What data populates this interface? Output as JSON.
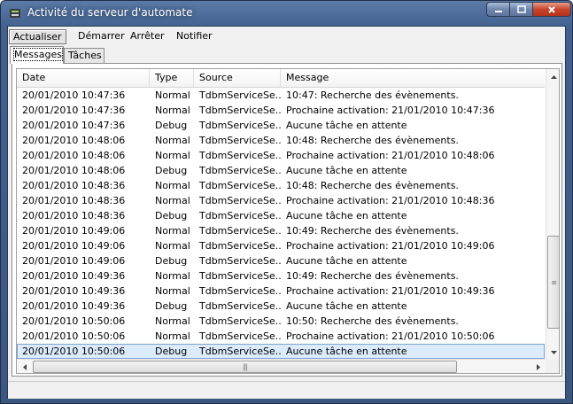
{
  "window": {
    "title": "Activité du serveur d'automate"
  },
  "menu": [
    {
      "label": "Actualiser"
    },
    {
      "label": "Démarrer"
    },
    {
      "label": "Arrêter"
    },
    {
      "label": "Notifier"
    }
  ],
  "tabs": [
    {
      "label": "Messages",
      "active": true
    },
    {
      "label": "Tâches",
      "active": false
    }
  ],
  "table": {
    "columns": [
      "Date",
      "Type",
      "Source",
      "Message"
    ],
    "rows": [
      [
        "20/01/2010 10:47:36",
        "Normal",
        "TdbmServiceSe...",
        "10:47: Recherche des évènements."
      ],
      [
        "20/01/2010 10:47:36",
        "Normal",
        "TdbmServiceSe...",
        "Prochaine activation: 21/01/2010 10:47:36"
      ],
      [
        "20/01/2010 10:47:36",
        "Debug",
        "TdbmServiceSe...",
        "Aucune tâche en attente"
      ],
      [
        "20/01/2010 10:48:06",
        "Normal",
        "TdbmServiceSe...",
        "10:48: Recherche des évènements."
      ],
      [
        "20/01/2010 10:48:06",
        "Normal",
        "TdbmServiceSe...",
        "Prochaine activation: 21/01/2010 10:48:06"
      ],
      [
        "20/01/2010 10:48:06",
        "Debug",
        "TdbmServiceSe...",
        "Aucune tâche en attente"
      ],
      [
        "20/01/2010 10:48:36",
        "Normal",
        "TdbmServiceSe...",
        "10:48: Recherche des évènements."
      ],
      [
        "20/01/2010 10:48:36",
        "Normal",
        "TdbmServiceSe...",
        "Prochaine activation: 21/01/2010 10:48:36"
      ],
      [
        "20/01/2010 10:48:36",
        "Debug",
        "TdbmServiceSe...",
        "Aucune tâche en attente"
      ],
      [
        "20/01/2010 10:49:06",
        "Normal",
        "TdbmServiceSe...",
        "10:49: Recherche des évènements."
      ],
      [
        "20/01/2010 10:49:06",
        "Normal",
        "TdbmServiceSe...",
        "Prochaine activation: 21/01/2010 10:49:06"
      ],
      [
        "20/01/2010 10:49:06",
        "Debug",
        "TdbmServiceSe...",
        "Aucune tâche en attente"
      ],
      [
        "20/01/2010 10:49:36",
        "Normal",
        "TdbmServiceSe...",
        "10:49: Recherche des évènements."
      ],
      [
        "20/01/2010 10:49:36",
        "Normal",
        "TdbmServiceSe...",
        "Prochaine activation: 21/01/2010 10:49:36"
      ],
      [
        "20/01/2010 10:49:36",
        "Debug",
        "TdbmServiceSe...",
        "Aucune tâche en attente"
      ],
      [
        "20/01/2010 10:50:06",
        "Normal",
        "TdbmServiceSe...",
        "10:50: Recherche des évènements."
      ],
      [
        "20/01/2010 10:50:06",
        "Normal",
        "TdbmServiceSe...",
        "Prochaine activation: 21/01/2010 10:50:06"
      ],
      [
        "20/01/2010 10:50:06",
        "Debug",
        "TdbmServiceSe...",
        "Aucune tâche en attente"
      ]
    ],
    "selected_row": 17
  },
  "icons": {
    "app": "server-icon",
    "minimize": "minimize-icon",
    "maximize": "maximize-icon",
    "close": "close-icon"
  },
  "colors": {
    "titlebar": "#4a6894",
    "selection": "#dcebfc",
    "close_button": "#c8432b"
  }
}
